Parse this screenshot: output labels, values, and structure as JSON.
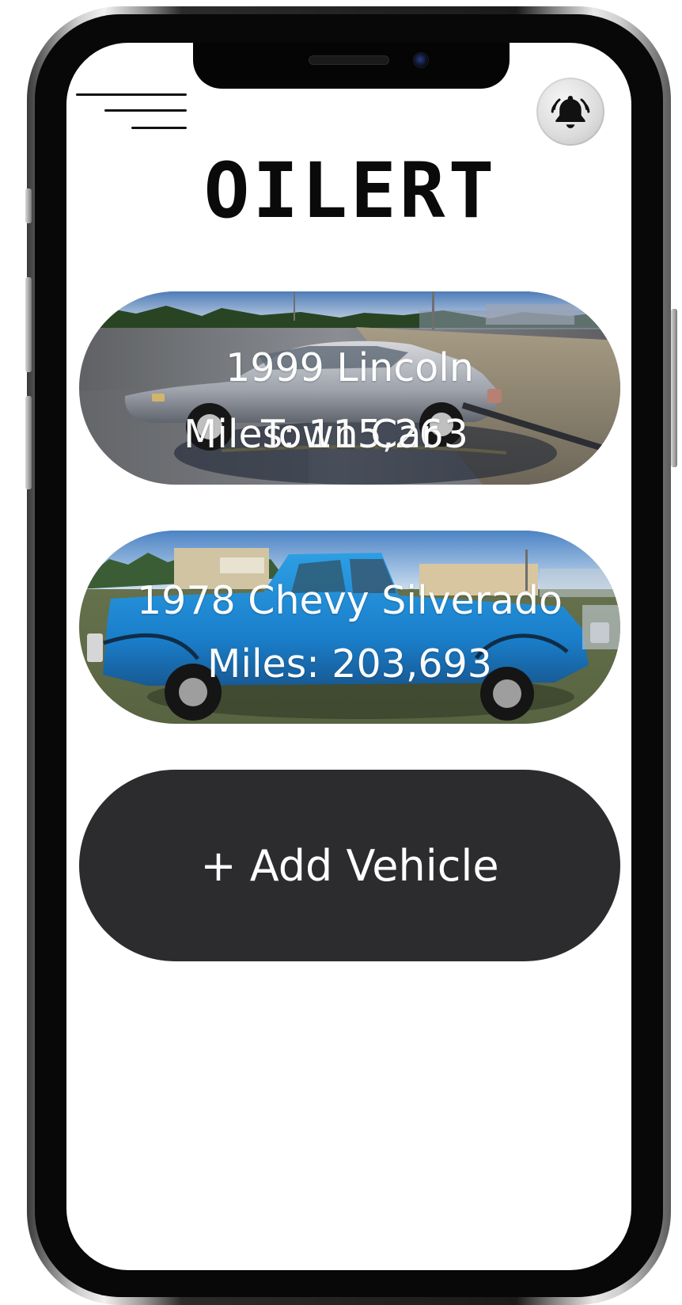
{
  "app": {
    "title": "OILERT"
  },
  "header": {
    "menu_icon": "hamburger-menu-icon",
    "notification_icon": "bell-icon"
  },
  "vehicles": [
    {
      "line1": "1999 Lincoln",
      "line2": "Miles: 115,263",
      "overlap_text": "Town Car"
    },
    {
      "line1": "1978 Chevy Silverado",
      "line2": "Miles: 203,693"
    }
  ],
  "actions": {
    "add_vehicle_label": "+ Add Vehicle"
  },
  "colors": {
    "button_bg": "#2c2c2e",
    "card_text": "#ffffff",
    "title_text": "#0a0a0a"
  }
}
